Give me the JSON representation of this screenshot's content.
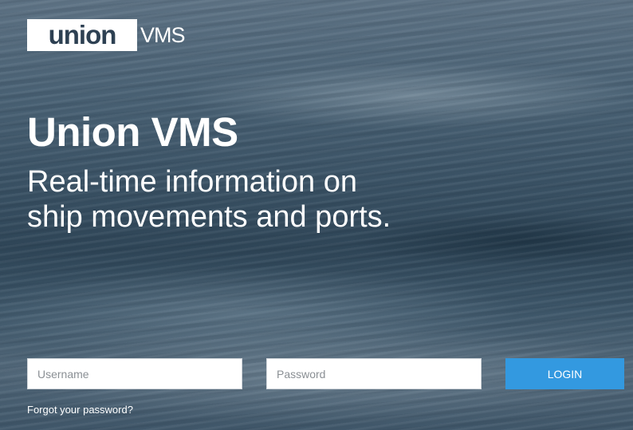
{
  "logo": {
    "main_text": "union",
    "sub_text": "VMS"
  },
  "hero": {
    "title": "Union VMS",
    "subtitle": "Real-time information on ship movements and ports."
  },
  "login_form": {
    "username_placeholder": "Username",
    "password_placeholder": "Password",
    "login_button": "LOGIN",
    "forgot_password": "Forgot your password?"
  },
  "colors": {
    "accent": "#3399e0",
    "logo_text": "#2d4052"
  }
}
